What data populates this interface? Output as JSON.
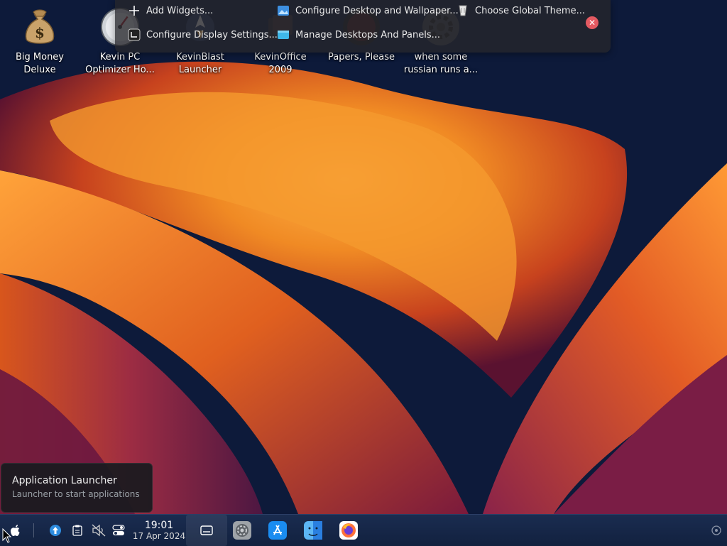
{
  "desktop": {
    "icons": [
      {
        "label": "Big Money\nDeluxe",
        "icon": "money-bag-icon"
      },
      {
        "label": "Kevin PC\nOptimizer Ho...",
        "icon": "gauge-icon"
      },
      {
        "label": "KevinBlast\nLauncher",
        "icon": "rocket-icon"
      },
      {
        "label": "KevinOffice\n2009",
        "icon": "office-icon"
      },
      {
        "label": "Papers, Please",
        "icon": "game-icon"
      },
      {
        "label": "when some\nrussian runs a...",
        "icon": "gear-icon"
      }
    ]
  },
  "edit_toolbar": {
    "add_widgets": "Add Widgets...",
    "configure_display": "Configure Display Settings...",
    "configure_desktop": "Configure Desktop and Wallpaper...",
    "manage_desktops": "Manage Desktops And Panels...",
    "choose_theme": "Choose Global Theme..."
  },
  "tooltip": {
    "title": "Application Launcher",
    "subtitle": "Launcher to start applications"
  },
  "panel": {
    "time": "19:01",
    "date": "17 Apr 2024"
  },
  "colors": {
    "panel_bg": "#1a2c50",
    "close_red": "#e35a62",
    "wall_orange": "#f08a24"
  }
}
